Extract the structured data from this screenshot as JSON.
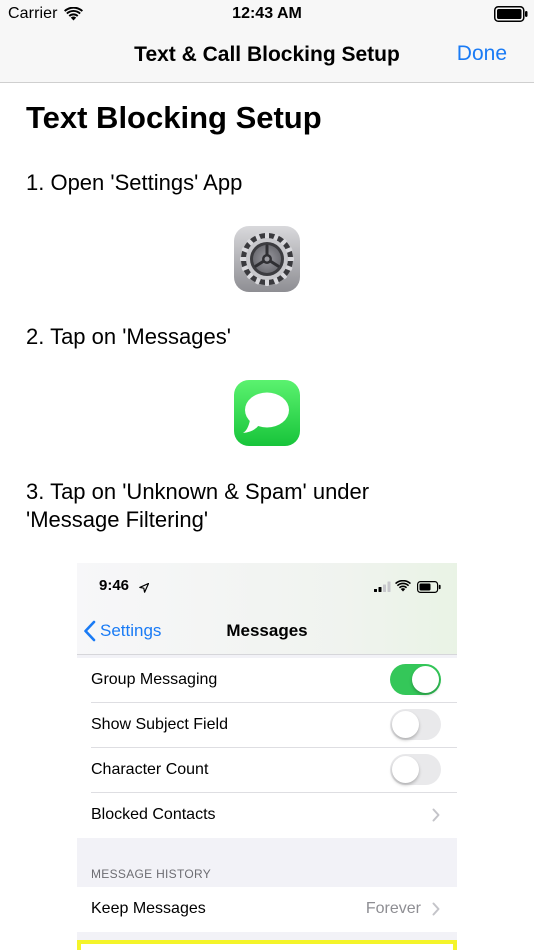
{
  "status_bar": {
    "carrier": "Carrier",
    "time": "12:43 AM"
  },
  "nav": {
    "title": "Text & Call Blocking Setup",
    "done_label": "Done"
  },
  "content": {
    "heading": "Text Blocking Setup",
    "step1": "1. Open 'Settings' App",
    "step2": "2. Tap on 'Messages'",
    "step3": "3. Tap on 'Unknown & Spam' under 'Message Filtering'"
  },
  "screenshot": {
    "time": "9:46",
    "back_label": "Settings",
    "title": "Messages",
    "rows": [
      {
        "label": "Group Messaging",
        "control": "toggle",
        "on": true
      },
      {
        "label": "Show Subject Field",
        "control": "toggle",
        "on": false
      },
      {
        "label": "Character Count",
        "control": "toggle",
        "on": false
      },
      {
        "label": "Blocked Contacts",
        "control": "chevron"
      }
    ],
    "section_header": "MESSAGE HISTORY",
    "keep_messages": {
      "label": "Keep Messages",
      "value": "Forever"
    }
  },
  "colors": {
    "accent": "#1a7bf5",
    "toggle_on": "#34c759",
    "highlight": "#f4f42a"
  },
  "icons": [
    "wifi-icon",
    "battery-icon",
    "settings-app-icon",
    "messages-app-icon",
    "location-arrow-icon",
    "cellular-signal-icon",
    "back-chevron-icon",
    "chevron-right-icon"
  ]
}
